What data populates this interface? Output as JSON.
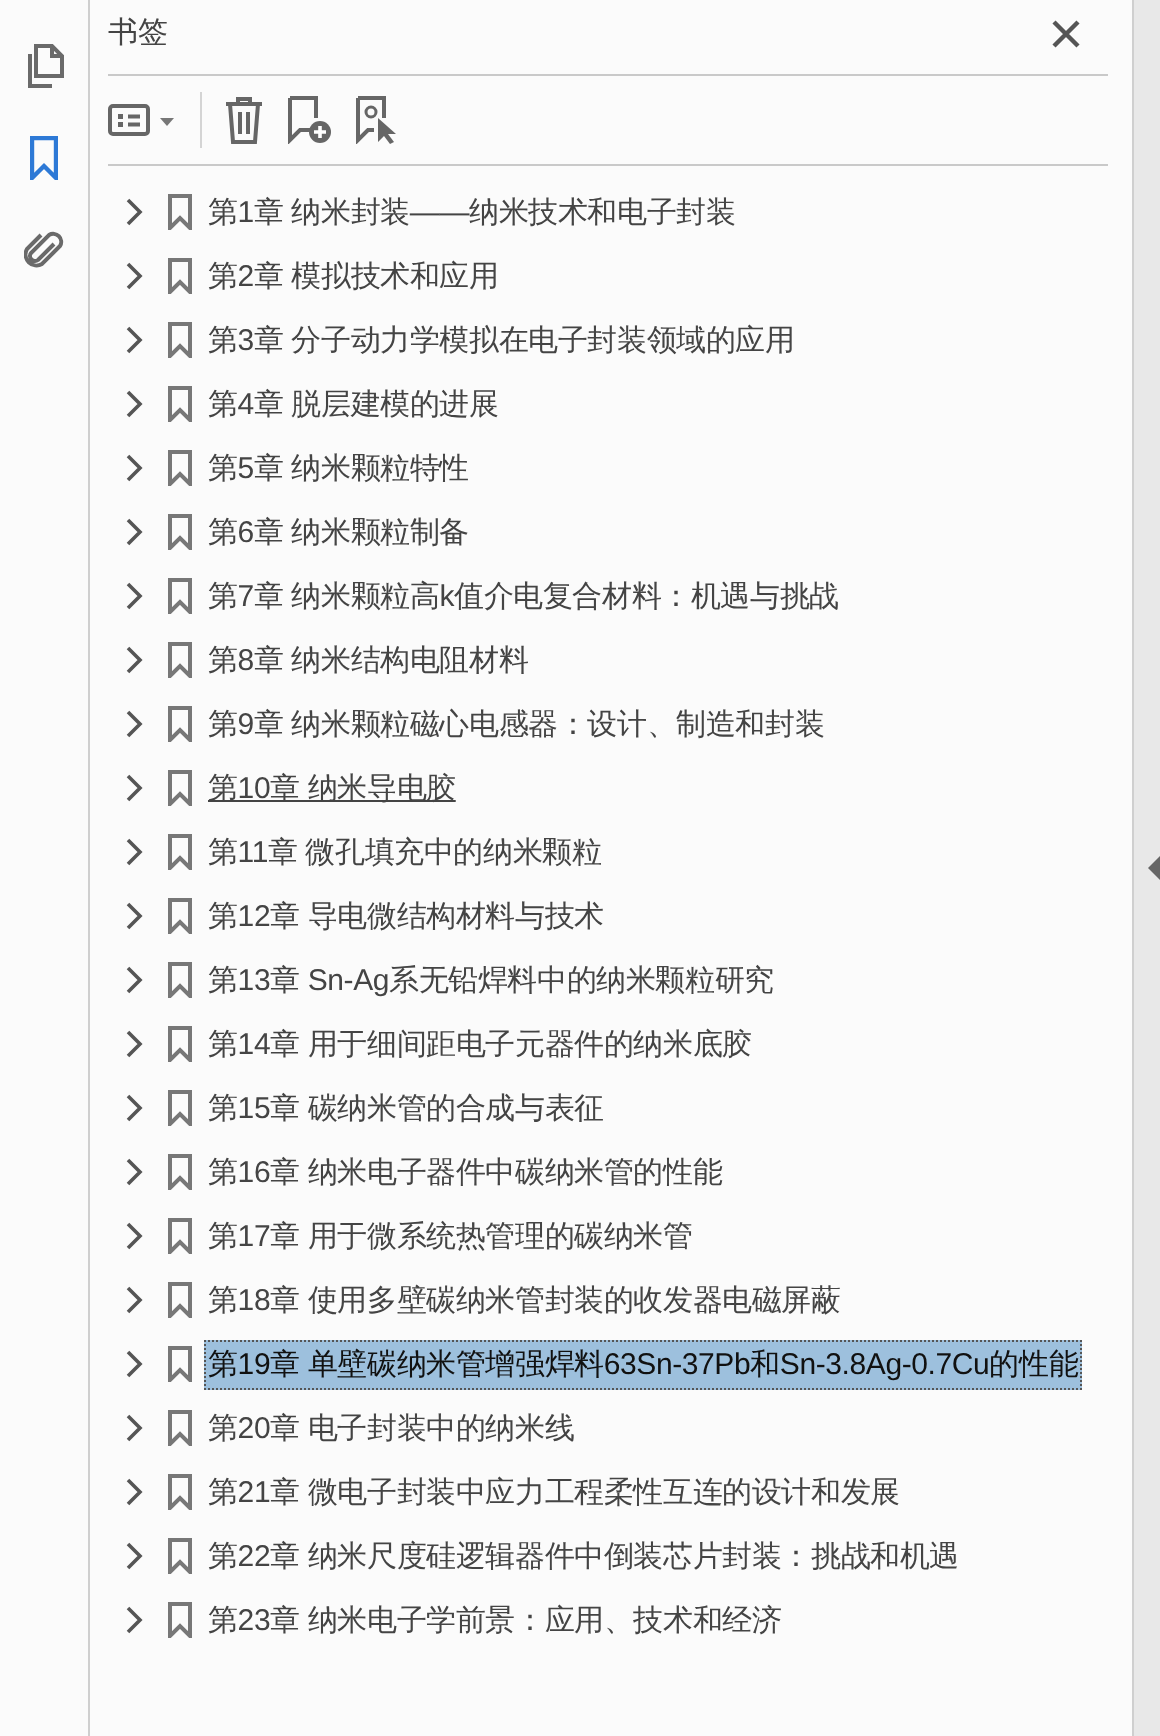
{
  "rail": [
    {
      "kind": "pages",
      "selected": false
    },
    {
      "kind": "bookmarks",
      "selected": true
    },
    {
      "kind": "attachments",
      "selected": false
    }
  ],
  "panel": {
    "title": "书签"
  },
  "bookmarks": [
    {
      "label": "第1章  纳米封装——纳米技术和电子封装",
      "expanded": false,
      "selected": false,
      "hovered": false
    },
    {
      "label": "第2章  模拟技术和应用",
      "expanded": false,
      "selected": false,
      "hovered": false
    },
    {
      "label": "第3章  分子动力学模拟在电子封装领域的应用",
      "expanded": false,
      "selected": false,
      "hovered": false
    },
    {
      "label": "第4章  脱层建模的进展",
      "expanded": false,
      "selected": false,
      "hovered": false
    },
    {
      "label": "第5章  纳米颗粒特性",
      "expanded": false,
      "selected": false,
      "hovered": false
    },
    {
      "label": "第6章  纳米颗粒制备",
      "expanded": false,
      "selected": false,
      "hovered": false
    },
    {
      "label": "第7章  纳米颗粒高k值介电复合材料：机遇与挑战",
      "expanded": false,
      "selected": false,
      "hovered": false
    },
    {
      "label": "第8章  纳米结构电阻材料",
      "expanded": false,
      "selected": false,
      "hovered": false
    },
    {
      "label": "第9章  纳米颗粒磁心电感器：设计、制造和封装",
      "expanded": false,
      "selected": false,
      "hovered": false
    },
    {
      "label": "第10章  纳米导电胶",
      "expanded": false,
      "selected": false,
      "hovered": true
    },
    {
      "label": "第11章  微孔填充中的纳米颗粒",
      "expanded": false,
      "selected": false,
      "hovered": false
    },
    {
      "label": "第12章  导电微结构材料与技术",
      "expanded": false,
      "selected": false,
      "hovered": false
    },
    {
      "label": "第13章  Sn-Ag系无铅焊料中的纳米颗粒研究",
      "expanded": false,
      "selected": false,
      "hovered": false
    },
    {
      "label": "第14章  用于细间距电子元器件的纳米底胶",
      "expanded": false,
      "selected": false,
      "hovered": false
    },
    {
      "label": "第15章  碳纳米管的合成与表征",
      "expanded": false,
      "selected": false,
      "hovered": false
    },
    {
      "label": "第16章  纳米电子器件中碳纳米管的性能",
      "expanded": false,
      "selected": false,
      "hovered": false
    },
    {
      "label": "第17章  用于微系统热管理的碳纳米管",
      "expanded": false,
      "selected": false,
      "hovered": false
    },
    {
      "label": "第18章  使用多壁碳纳米管封装的收发器电磁屏蔽",
      "expanded": false,
      "selected": false,
      "hovered": false
    },
    {
      "label": "第19章  单壁碳纳米管增强焊料63Sn-37Pb和Sn-3.8Ag-0.7Cu的性能",
      "expanded": false,
      "selected": true,
      "hovered": false
    },
    {
      "label": "第20章  电子封装中的纳米线",
      "expanded": false,
      "selected": false,
      "hovered": false
    },
    {
      "label": "第21章  微电子封装中应力工程柔性互连的设计和发展",
      "expanded": false,
      "selected": false,
      "hovered": false
    },
    {
      "label": "第22章  纳米尺度硅逻辑器件中倒装芯片封装：挑战和机遇",
      "expanded": false,
      "selected": false,
      "hovered": false
    },
    {
      "label": "第23章  纳米电子学前景：应用、技术和经济",
      "expanded": false,
      "selected": false,
      "hovered": false
    }
  ]
}
